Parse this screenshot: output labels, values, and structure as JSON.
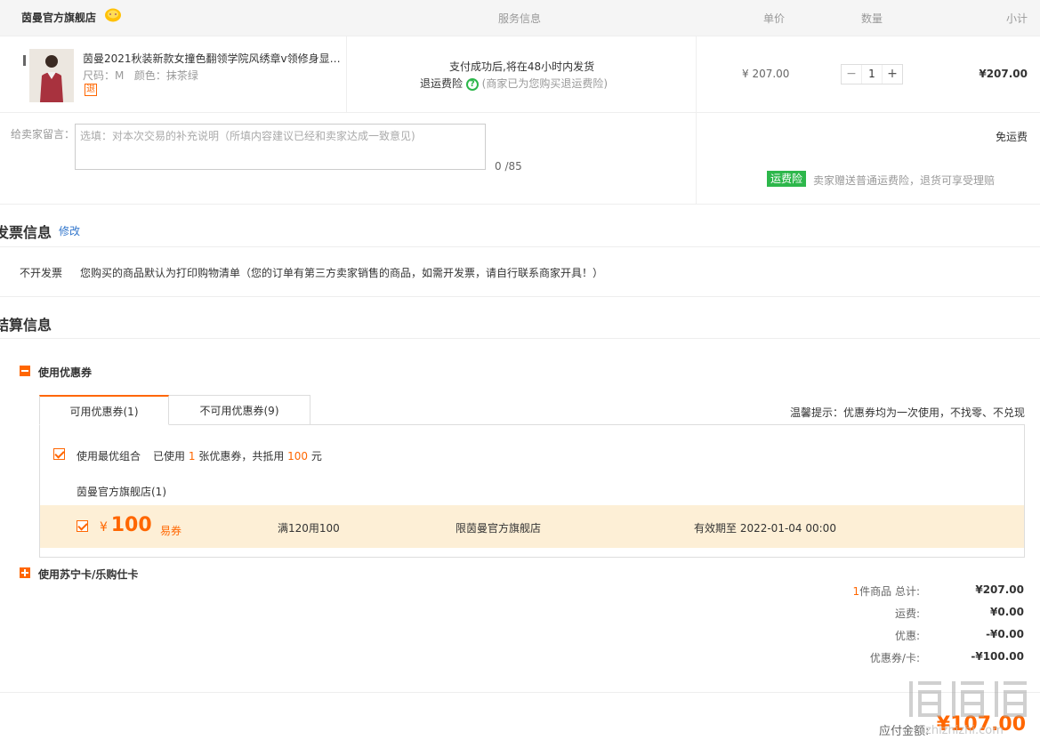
{
  "header": {
    "shop_name": "茵曼官方旗舰店",
    "col_service": "服务信息",
    "col_price": "单价",
    "col_qty": "数量",
    "col_subtotal": "小计"
  },
  "product": {
    "title": "茵曼2021秋装新款女撞色翻领学院风绣章v领修身显…",
    "size_label": "尺码：",
    "size_value": "M",
    "color_label": "颜色：",
    "color_value": "抹茶绿",
    "return_badge": "退",
    "service_text": "支付成功后,将在48小时内发货",
    "insurance_label": "退运费险",
    "insurance_note": "(商家已为您购买退运费险)",
    "price": "¥ 207.00",
    "quantity": "1",
    "subtotal": "¥207.00"
  },
  "message": {
    "label": "给卖家留言：",
    "placeholder": "选填：对本次交易的补充说明（所填内容建议已经和卖家达成一致意见)",
    "counter": "0 /85"
  },
  "shipping": {
    "free_text": "免运费",
    "tag": "运费险",
    "note": "卖家赠送普通运费险，退货可享受理赔"
  },
  "invoice": {
    "title": "发票信息",
    "edit_link": "修改",
    "type": "不开发票",
    "note": "您购买的商品默认为打印购物清单（您的订单有第三方卖家销售的商品，如需开发票，请自行联系商家开具！）"
  },
  "settlement": {
    "title": "结算信息",
    "use_coupon": "使用优惠券",
    "tab_available": "可用优惠券(1)",
    "tab_unavailable": "不可用优惠券(9)",
    "tip": "温馨提示：优惠券均为一次使用，不找零、不兑现",
    "best_combo": "使用最优组合",
    "used_prefix": "已使用",
    "used_count": "1",
    "used_mid": "张优惠券，共抵用",
    "used_amount": "100",
    "used_suffix": "元",
    "store_group": "茵曼官方旗舰店(1)",
    "coupon": {
      "currency": "¥",
      "amount": "100",
      "type": "易券",
      "condition": "满120用100",
      "scope": "限茵曼官方旗舰店",
      "expiry": "有效期至 2022-01-04 00:00"
    },
    "use_card": "使用苏宁卡/乐购仕卡"
  },
  "summary": {
    "items_count": "1",
    "items_label": "件商品 总计:",
    "items_total": "¥207.00",
    "shipping_label": "运费:",
    "shipping_value": "¥0.00",
    "discount_label": "优惠:",
    "discount_value": "-¥0.00",
    "coupon_label": "优惠券/卡:",
    "coupon_value": "-¥100.00",
    "payable_label": "应付金额:",
    "payable_value": "¥107.00"
  },
  "watermark": {
    "text": "zhizhizhi.com"
  },
  "colors": {
    "accent": "#ff6600",
    "green": "#2db74b",
    "coupon_bg": "#fdefd6",
    "link": "#3377cc"
  }
}
